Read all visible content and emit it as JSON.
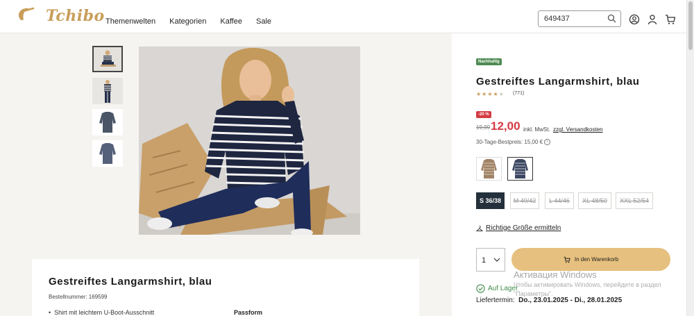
{
  "header": {
    "logo_text": "Tchibo",
    "nav": [
      "Themenwelten",
      "Kategorien",
      "Kaffee",
      "Sale"
    ],
    "search_value": "649437"
  },
  "colors": {
    "brand_gold": "#c89e5a",
    "cart_button": "#e6c07e",
    "sale_red": "#d43b43",
    "eco_green": "#4e8b52",
    "selected_size": "#24303b"
  },
  "product": {
    "badge_sustainable": "Nachhaltig",
    "title": "Gestreiftes Langarmshirt, blau",
    "rating_stars": 4,
    "rating_count": "(771)",
    "discount_badge": "-20 %",
    "old_price": "19,99",
    "new_price": "12,00",
    "vat_text": "inkl. MwSt.",
    "shipping_link": "zzgl. Versandkosten",
    "best_price": "30-Tage-Bestpreis: 15,00 €",
    "sizes": [
      "S 36/38",
      "M 40/42",
      "L 44/46",
      "XL 48/50",
      "XXL 52/54"
    ],
    "size_guide": "Richtige Größe ermitteln",
    "quantity": "1",
    "cart_label": "In den Warenkorb",
    "stock": "Auf Lager",
    "delivery_label": "Liefertermin:",
    "delivery_dates": "Do., 23.01.2025 - Di., 28.01.2025"
  },
  "details": {
    "title": "Gestreiftes Langarmshirt, blau",
    "order_number": "Bestellnummer: 169599",
    "bullet": "Shirt mit leichtem U-Boot-Ausschnitt",
    "passform": "Passform"
  },
  "watermark": {
    "title": "Активация Windows",
    "subtitle": "Чтобы активировать Windows, перейдите в раздел \"Параметры\"."
  }
}
